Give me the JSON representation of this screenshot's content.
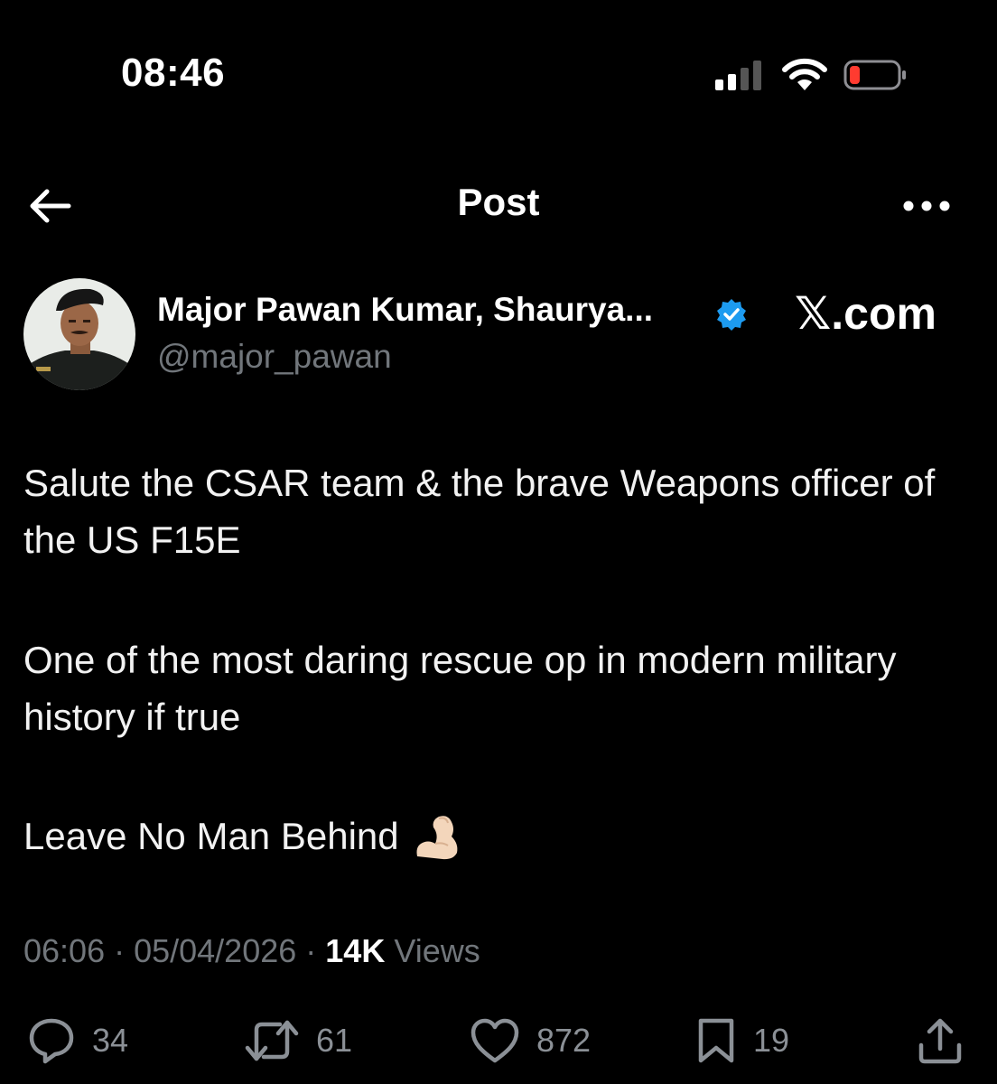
{
  "status_bar": {
    "time": "08:46",
    "battery_color": "#ff3b30"
  },
  "header": {
    "title": "Post"
  },
  "author": {
    "display_name": "Major Pawan Kumar, Shaurya...",
    "handle": "@major_pawan",
    "verified": true,
    "verified_color": "#1d9bf0"
  },
  "watermark": "𝕏.com",
  "post": {
    "paragraph_1": "Salute the CSAR team & the brave Weapons officer of the US F15E",
    "paragraph_2": "One of the most daring rescue op in modern military history if true",
    "paragraph_3": "Leave No Man Behind",
    "emoji": "flexed-biceps-icon"
  },
  "meta": {
    "time": "06:06",
    "separator": " · ",
    "date": "05/04/2026",
    "views_count": "14K",
    "views_label": " Views"
  },
  "actions": {
    "replies": "34",
    "reposts": "61",
    "likes": "872",
    "bookmarks": "19"
  },
  "colors": {
    "background": "#000000",
    "text": "#e7e9ea",
    "muted": "#71767b"
  }
}
